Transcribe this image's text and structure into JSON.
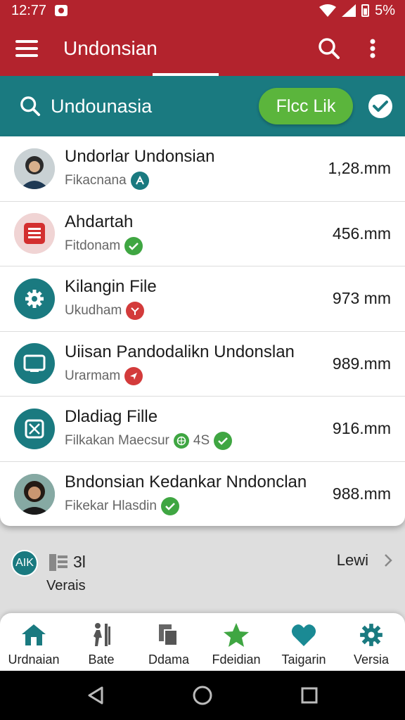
{
  "status_bar": {
    "time": "12:77",
    "battery_text": "5%"
  },
  "app_bar": {
    "title": "Undonsian"
  },
  "search": {
    "query": "Undounasia",
    "filter_button": "Flcc Lik"
  },
  "files": [
    {
      "title": "Undorlar Undonsian",
      "subtitle": "Fikacnana",
      "size": "1,28.mm",
      "avatar": "person-photo-1",
      "badge_icon": "share-icon",
      "badge_color": "#1a7a80"
    },
    {
      "title": "Ahdartah",
      "subtitle": "Fitdonam",
      "size": "456.mm",
      "avatar": "document-icon",
      "badge_icon": "check-icon",
      "badge_color": "#3fa642"
    },
    {
      "title": "Kilangin File",
      "subtitle": "Ukudham",
      "size": "973 mm",
      "avatar": "gear-icon",
      "badge_icon": "share-icon",
      "badge_color": "#d33b3b"
    },
    {
      "title": "Uiisan Pandodalikn Undonslan",
      "subtitle": "Urarmam",
      "size": "989.mm",
      "avatar": "screen-icon",
      "badge_icon": "send-icon",
      "badge_color": "#d33b3b"
    },
    {
      "title": "Dladiag Fille",
      "subtitle": "Filkakan Maecsur",
      "extra": "4S",
      "size": "916.mm",
      "avatar": "image-box-icon",
      "badge_icon": "check-icon",
      "badge_color": "#3fa642"
    },
    {
      "title": "Bndonsian Kedankar Nndonclan",
      "subtitle": "Fikekar Hlasdin",
      "size": "988.mm",
      "avatar": "person-photo-2",
      "badge_icon": "check-icon",
      "badge_color": "#3fa642"
    }
  ],
  "summary": {
    "badge": "AIK",
    "count": "3l",
    "versions_label": "Verais",
    "link_label": "Lewi"
  },
  "bottom_nav": [
    {
      "label": "Urdnaian",
      "icon": "home-icon",
      "color": "#1a7a80"
    },
    {
      "label": "Bate",
      "icon": "walking-person-icon",
      "color": "#555555"
    },
    {
      "label": "Ddama",
      "icon": "documents-icon",
      "color": "#555555"
    },
    {
      "label": "Fdeidian",
      "icon": "star-icon",
      "color": "#3fa642"
    },
    {
      "label": "Taigarin",
      "icon": "heart-icon",
      "color": "#1a8a94"
    },
    {
      "label": "Versia",
      "icon": "gear-icon",
      "color": "#1a7a80"
    }
  ]
}
